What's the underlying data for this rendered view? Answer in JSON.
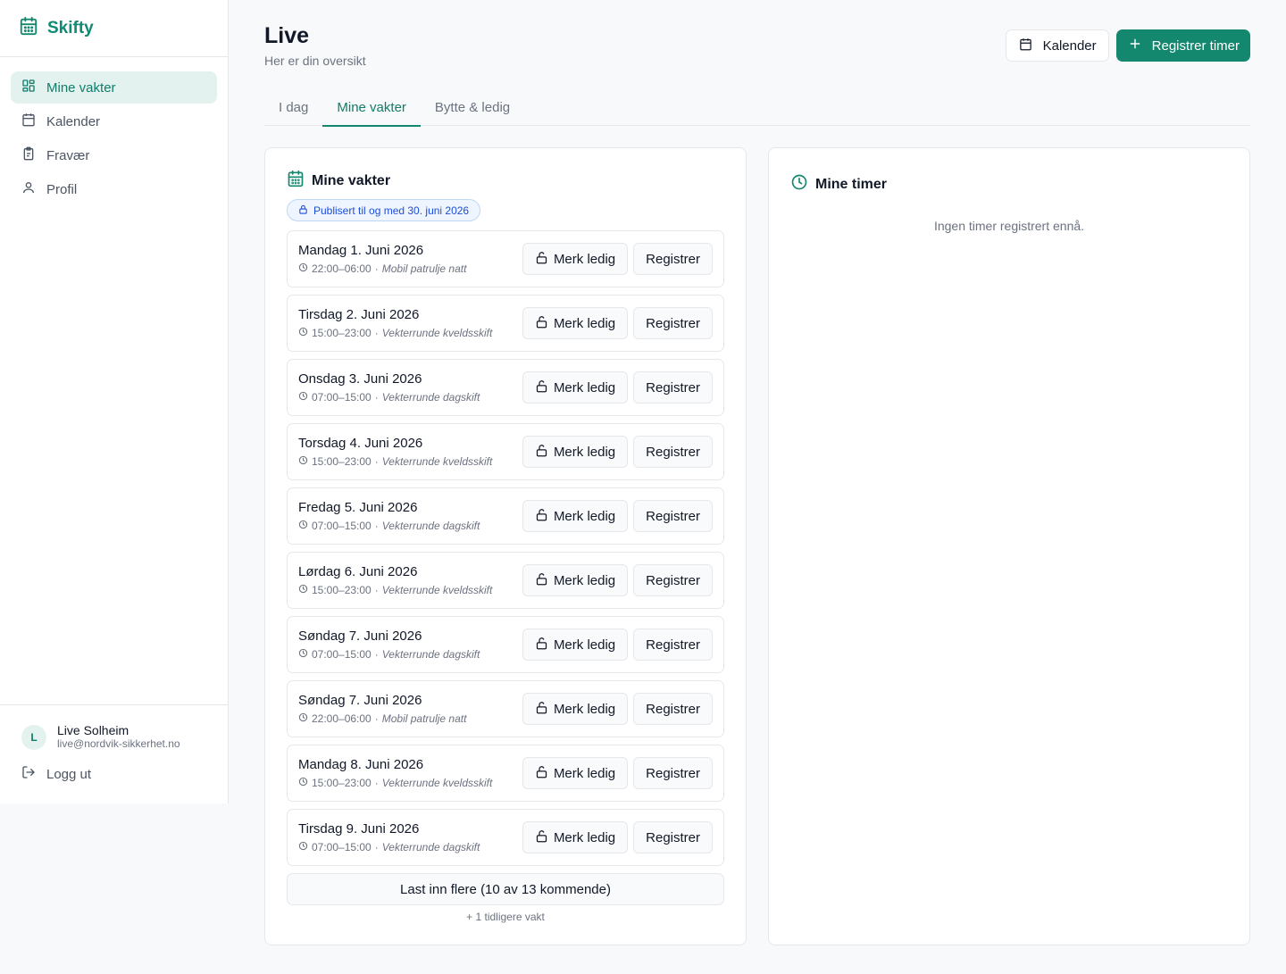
{
  "app": {
    "name": "Skifty",
    "accent": "#14876f"
  },
  "sidebar": {
    "items": [
      {
        "label": "Mine vakter",
        "icon": "dashboard-icon",
        "active": true
      },
      {
        "label": "Kalender",
        "icon": "calendar-icon",
        "active": false
      },
      {
        "label": "Fravær",
        "icon": "clipboard-icon",
        "active": false
      },
      {
        "label": "Profil",
        "icon": "user-icon",
        "active": false
      }
    ],
    "user": {
      "initial": "L",
      "name": "Live Solheim",
      "email": "live@nordvik-sikkerhet.no"
    },
    "logout_label": "Logg ut"
  },
  "header": {
    "title": "Live",
    "subtitle": "Her er din oversikt",
    "calendar_button": "Kalender",
    "register_button": "Registrer timer"
  },
  "tabs": [
    {
      "label": "I dag",
      "active": false
    },
    {
      "label": "Mine vakter",
      "active": true
    },
    {
      "label": "Bytte & ledig",
      "active": false
    }
  ],
  "shifts_card": {
    "title": "Mine vakter",
    "badge": "Publisert til og med 30. juni 2026",
    "mark_free_label": "Merk ledig",
    "register_label": "Registrer",
    "shifts": [
      {
        "date": "Mandag 1. Juni 2026",
        "time": "22:00–06:00",
        "type": "Mobil patrulje natt"
      },
      {
        "date": "Tirsdag 2. Juni 2026",
        "time": "15:00–23:00",
        "type": "Vekterrunde kveldsskift"
      },
      {
        "date": "Onsdag 3. Juni 2026",
        "time": "07:00–15:00",
        "type": "Vekterrunde dagskift"
      },
      {
        "date": "Torsdag 4. Juni 2026",
        "time": "15:00–23:00",
        "type": "Vekterrunde kveldsskift"
      },
      {
        "date": "Fredag 5. Juni 2026",
        "time": "07:00–15:00",
        "type": "Vekterrunde dagskift"
      },
      {
        "date": "Lørdag 6. Juni 2026",
        "time": "15:00–23:00",
        "type": "Vekterrunde kveldsskift"
      },
      {
        "date": "Søndag 7. Juni 2026",
        "time": "07:00–15:00",
        "type": "Vekterrunde dagskift"
      },
      {
        "date": "Søndag 7. Juni 2026",
        "time": "22:00–06:00",
        "type": "Mobil patrulje natt"
      },
      {
        "date": "Mandag 8. Juni 2026",
        "time": "15:00–23:00",
        "type": "Vekterrunde kveldsskift"
      },
      {
        "date": "Tirsdag 9. Juni 2026",
        "time": "07:00–15:00",
        "type": "Vekterrunde dagskift"
      }
    ],
    "load_more_label": "Last inn flere (10 av 13 kommende)",
    "earlier_label": "+ 1 tidligere vakt"
  },
  "hours_card": {
    "title": "Mine timer",
    "empty_text": "Ingen timer registrert ennå."
  }
}
